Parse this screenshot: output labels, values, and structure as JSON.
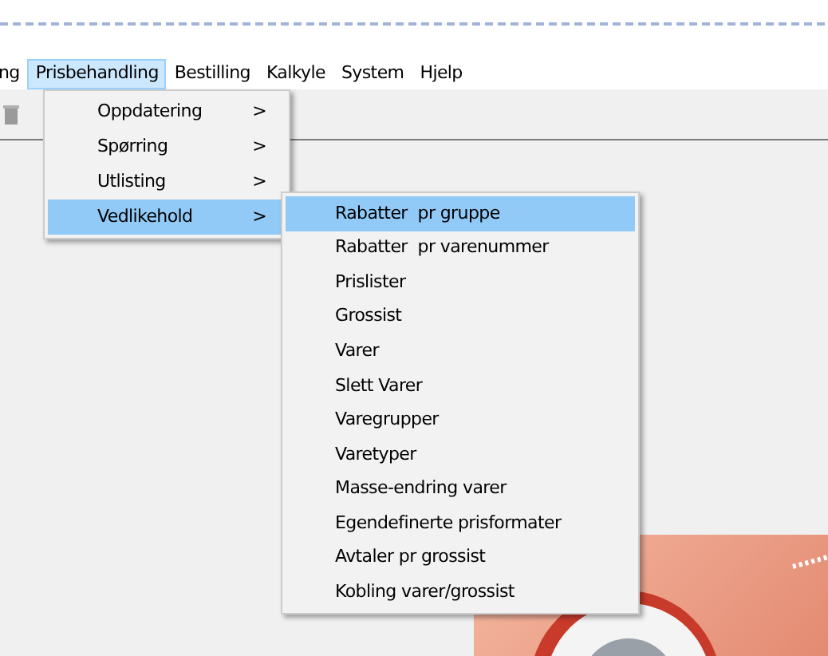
{
  "menubar": [
    {
      "label": "ng",
      "selected": false
    },
    {
      "label": "Prisbehandling",
      "selected": true
    },
    {
      "label": "Bestilling",
      "selected": false
    },
    {
      "label": "Kalkyle",
      "selected": false
    },
    {
      "label": "System",
      "selected": false
    },
    {
      "label": "Hjelp",
      "selected": false
    }
  ],
  "dropdown": [
    {
      "label": "Oppdatering",
      "arrow": ">",
      "selected": false
    },
    {
      "label": "Spørring",
      "arrow": ">",
      "selected": false
    },
    {
      "label": "Utlisting",
      "arrow": ">",
      "selected": false
    },
    {
      "label": "Vedlikehold",
      "arrow": ">",
      "selected": true
    }
  ],
  "submenu": [
    {
      "label": "Rabatter  pr gruppe",
      "selected": true
    },
    {
      "label": "Rabatter  pr varenummer",
      "selected": false
    },
    {
      "label": "Prislister",
      "selected": false
    },
    {
      "label": "Grossist",
      "selected": false
    },
    {
      "label": "Varer",
      "selected": false
    },
    {
      "label": "Slett Varer",
      "selected": false
    },
    {
      "label": "Varegrupper",
      "selected": false
    },
    {
      "label": "Varetyper",
      "selected": false
    },
    {
      "label": "Masse-endring varer",
      "selected": false
    },
    {
      "label": "Egendefinerte prisformater",
      "selected": false
    },
    {
      "label": "Avtaler pr grossist",
      "selected": false
    },
    {
      "label": "Kobling varer/grossist",
      "selected": false
    }
  ]
}
